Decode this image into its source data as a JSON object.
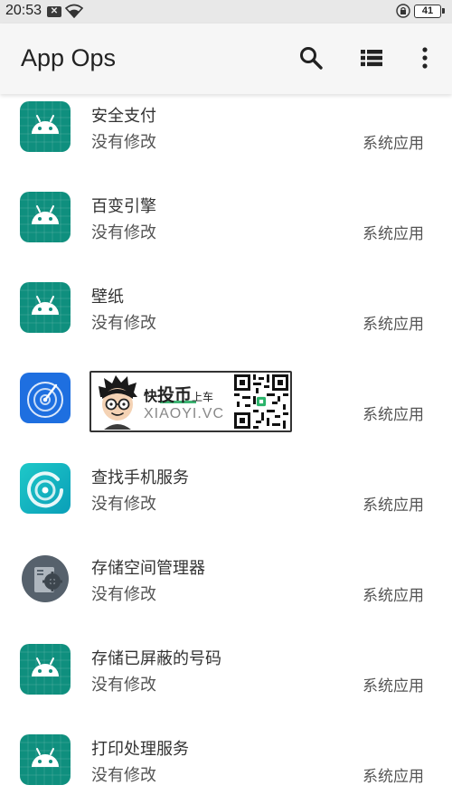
{
  "status_bar": {
    "time": "20:53",
    "notification_glyph": "✕",
    "battery": "41"
  },
  "app_bar": {
    "title": "App Ops",
    "icons": [
      "search-icon",
      "list-view-icon",
      "more-vert-icon"
    ]
  },
  "apps": [
    {
      "name": "安全支付",
      "status": "没有修改",
      "type": "系统应用",
      "icon": "android-icon"
    },
    {
      "name": "百变引擎",
      "status": "没有修改",
      "type": "系统应用",
      "icon": "android-icon"
    },
    {
      "name": "壁纸",
      "status": "没有修改",
      "type": "系统应用",
      "icon": "android-icon"
    },
    {
      "name": "",
      "status": "",
      "type": "系统应用",
      "icon": "radar-icon"
    },
    {
      "name": "查找手机服务",
      "status": "没有修改",
      "type": "系统应用",
      "icon": "find-phone-icon"
    },
    {
      "name": "存储空间管理器",
      "status": "没有修改",
      "type": "系统应用",
      "icon": "storage-manager-icon"
    },
    {
      "name": "存储已屏蔽的号码",
      "status": "没有修改",
      "type": "系统应用",
      "icon": "android-icon"
    },
    {
      "name": "打印处理服务",
      "status": "没有修改",
      "type": "系统应用",
      "icon": "android-icon"
    }
  ],
  "watermark": {
    "line1_a": "快",
    "line1_b": "投币",
    "line1_c": "上车",
    "line2": "XIAOYI.VC"
  },
  "colors": {
    "android_tile": "#0f8f7e",
    "radar_blue": "#1e6fe0",
    "find_teal": "#0bb6c4",
    "appbar_bg": "#f6f6f6"
  }
}
